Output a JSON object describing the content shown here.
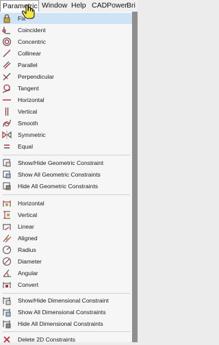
{
  "menubar": {
    "items": [
      {
        "label": "Parametric",
        "active": true
      },
      {
        "label": "Window"
      },
      {
        "label": "Help"
      },
      {
        "label": "CADPower"
      },
      {
        "label": "Bri"
      }
    ]
  },
  "menu": {
    "groups": [
      [
        {
          "label": "Fix",
          "icon": "fix-lock-icon",
          "highlighted": true
        },
        {
          "label": "Coincident",
          "icon": "coincident-icon"
        },
        {
          "label": "Concentric",
          "icon": "concentric-icon"
        },
        {
          "label": "Collinear",
          "icon": "collinear-icon"
        },
        {
          "label": "Parallel",
          "icon": "parallel-icon"
        },
        {
          "label": "Perpendicular",
          "icon": "perpendicular-icon"
        },
        {
          "label": "Tangent",
          "icon": "tangent-icon"
        },
        {
          "label": "Horizontal",
          "icon": "horizontal-icon"
        },
        {
          "label": "Vertical",
          "icon": "vertical-icon"
        },
        {
          "label": "Smooth",
          "icon": "smooth-icon"
        },
        {
          "label": "Symmetric",
          "icon": "symmetric-icon"
        },
        {
          "label": "Equal",
          "icon": "equal-icon"
        }
      ],
      [
        {
          "label": "Show/Hide Geometric Constraint",
          "icon": "show-hide-geometric-icon"
        },
        {
          "label": "Show All Geometric Constraints",
          "icon": "show-all-geometric-icon"
        },
        {
          "label": "Hide All Geometric Constraints",
          "icon": "hide-all-geometric-icon"
        }
      ],
      [
        {
          "label": "Horizontal",
          "icon": "dim-horizontal-icon"
        },
        {
          "label": "Vertical",
          "icon": "dim-vertical-icon"
        },
        {
          "label": "Linear",
          "icon": "dim-linear-icon"
        },
        {
          "label": "Aligned",
          "icon": "dim-aligned-icon"
        },
        {
          "label": "Radius",
          "icon": "dim-radius-icon"
        },
        {
          "label": "Diameter",
          "icon": "dim-diameter-icon"
        },
        {
          "label": "Angular",
          "icon": "dim-angular-icon"
        },
        {
          "label": "Convert",
          "icon": "dim-convert-icon"
        }
      ],
      [
        {
          "label": "Show/Hide Dimensional Constraint",
          "icon": "show-hide-dimensional-icon"
        },
        {
          "label": "Show All Dimensional Constraints",
          "icon": "show-all-dimensional-icon"
        },
        {
          "label": "Hide All Dimensional Constraints",
          "icon": "hide-all-dimensional-icon"
        }
      ],
      [
        {
          "label": "Delete 2D Constraints",
          "icon": "delete-constraints-icon"
        }
      ]
    ]
  },
  "colors": {
    "highlight": "#cfe3f6",
    "icon_accent": "#b5333a",
    "cursor_fill": "#f4e542"
  }
}
